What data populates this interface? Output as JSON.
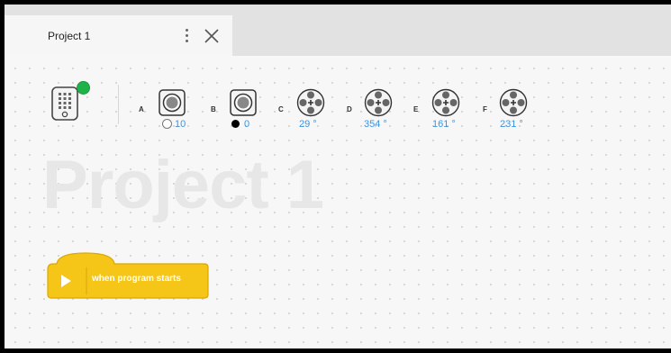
{
  "tab": {
    "label": "Project 1"
  },
  "canvas": {
    "watermark": "Project 1"
  },
  "hub": {
    "connected": true,
    "status_color": "#20b24a"
  },
  "ports": [
    {
      "letter": "A",
      "type": "color-sensor",
      "indicator": "empty",
      "value": "10"
    },
    {
      "letter": "B",
      "type": "color-sensor",
      "indicator": "black",
      "value": "0"
    },
    {
      "letter": "C",
      "type": "motor",
      "value": "29 °"
    },
    {
      "letter": "D",
      "type": "motor",
      "value": "354 °"
    },
    {
      "letter": "E",
      "type": "motor",
      "value": "161 °"
    },
    {
      "letter": "F",
      "type": "motor",
      "value": "231 °"
    }
  ],
  "block": {
    "label": "when program starts",
    "color": "#f5c518"
  },
  "colors": {
    "accent_value": "#3e93e0",
    "block": "#f5c518"
  }
}
